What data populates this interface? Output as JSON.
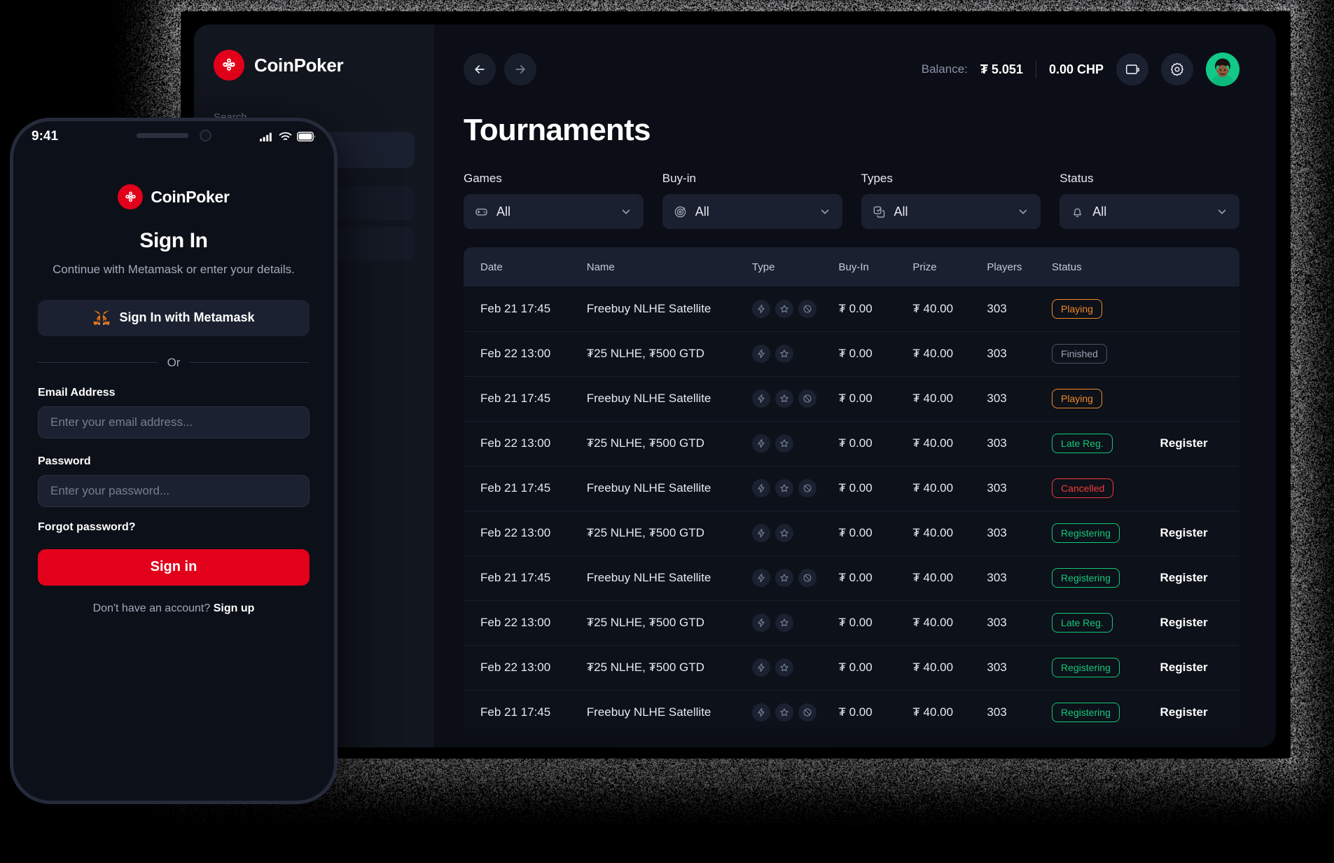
{
  "brand": {
    "name": "CoinPoker",
    "logo_icon": "coinpoker-clover-logo",
    "accent": "#e2001a"
  },
  "desktop": {
    "sidebar": {
      "search_label": "Search",
      "nav_items": [
        {
          "label": ""
        },
        {
          "label": ""
        }
      ]
    },
    "topbar": {
      "back_icon": "arrow-left-icon",
      "forward_icon": "arrow-right-icon",
      "balance_label": "Balance:",
      "balance_value": "₮ 5.051",
      "chp_value": "0.00 CHP",
      "wallet_icon": "wallet-icon",
      "settings_icon": "gear-icon",
      "avatar_icon": "user-avatar"
    },
    "page_title": "Tournaments",
    "filters": [
      {
        "label": "Games",
        "value": "All",
        "icon": "gamepad-icon",
        "chevron": "chevron-down-icon"
      },
      {
        "label": "Buy-in",
        "value": "All",
        "icon": "chip-icon",
        "chevron": "chevron-down-icon"
      },
      {
        "label": "Types",
        "value": "All",
        "icon": "copy-icon",
        "chevron": "chevron-down-icon"
      },
      {
        "label": "Status",
        "value": "All",
        "icon": "bell-icon",
        "chevron": "chevron-down-icon"
      }
    ],
    "table": {
      "columns": [
        "Date",
        "Name",
        "Type",
        "Buy-In",
        "Prize",
        "Players",
        "Status",
        ""
      ],
      "rows": [
        {
          "date": "Feb 21 17:45",
          "name": "Freebuy NLHE Satellite",
          "types": [
            "bolt-icon",
            "star-icon",
            "no-rebuy-icon"
          ],
          "buyin": "₮ 0.00",
          "prize": "₮ 40.00",
          "players": "303",
          "status": "Playing",
          "status_kind": "playing",
          "action": ""
        },
        {
          "date": "Feb 22 13:00",
          "name": "₮25 NLHE, ₮500 GTD",
          "types": [
            "bolt-icon",
            "star-icon"
          ],
          "buyin": "₮ 0.00",
          "prize": "₮ 40.00",
          "players": "303",
          "status": "Finished",
          "status_kind": "finished",
          "action": ""
        },
        {
          "date": "Feb 21 17:45",
          "name": "Freebuy NLHE Satellite",
          "types": [
            "bolt-icon",
            "star-icon",
            "no-rebuy-icon"
          ],
          "buyin": "₮ 0.00",
          "prize": "₮ 40.00",
          "players": "303",
          "status": "Playing",
          "status_kind": "playing",
          "action": ""
        },
        {
          "date": "Feb 22 13:00",
          "name": "₮25 NLHE, ₮500 GTD",
          "types": [
            "bolt-icon",
            "star-icon"
          ],
          "buyin": "₮ 0.00",
          "prize": "₮ 40.00",
          "players": "303",
          "status": "Late Reg.",
          "status_kind": "latereg",
          "action": "Register"
        },
        {
          "date": "Feb 21 17:45",
          "name": "Freebuy NLHE Satellite",
          "types": [
            "bolt-icon",
            "star-icon",
            "no-rebuy-icon"
          ],
          "buyin": "₮ 0.00",
          "prize": "₮ 40.00",
          "players": "303",
          "status": "Cancelled",
          "status_kind": "cancelled",
          "action": ""
        },
        {
          "date": "Feb 22 13:00",
          "name": "₮25 NLHE, ₮500 GTD",
          "types": [
            "bolt-icon",
            "star-icon"
          ],
          "buyin": "₮ 0.00",
          "prize": "₮ 40.00",
          "players": "303",
          "status": "Registering",
          "status_kind": "registering",
          "action": "Register"
        },
        {
          "date": "Feb 21 17:45",
          "name": "Freebuy NLHE Satellite",
          "types": [
            "bolt-icon",
            "star-icon",
            "no-rebuy-icon"
          ],
          "buyin": "₮ 0.00",
          "prize": "₮ 40.00",
          "players": "303",
          "status": "Registering",
          "status_kind": "registering",
          "action": "Register"
        },
        {
          "date": "Feb 22 13:00",
          "name": "₮25 NLHE, ₮500 GTD",
          "types": [
            "bolt-icon",
            "star-icon"
          ],
          "buyin": "₮ 0.00",
          "prize": "₮ 40.00",
          "players": "303",
          "status": "Late Reg.",
          "status_kind": "latereg",
          "action": "Register"
        },
        {
          "date": "Feb 22 13:00",
          "name": "₮25 NLHE, ₮500 GTD",
          "types": [
            "bolt-icon",
            "star-icon"
          ],
          "buyin": "₮ 0.00",
          "prize": "₮ 40.00",
          "players": "303",
          "status": "Registering",
          "status_kind": "registering",
          "action": "Register"
        },
        {
          "date": "Feb 21 17:45",
          "name": "Freebuy NLHE Satellite",
          "types": [
            "bolt-icon",
            "star-icon",
            "no-rebuy-icon"
          ],
          "buyin": "₮ 0.00",
          "prize": "₮ 40.00",
          "players": "303",
          "status": "Registering",
          "status_kind": "registering",
          "action": "Register"
        }
      ]
    }
  },
  "phone": {
    "status_bar": {
      "time": "9:41",
      "signal_icon": "cellular-signal-icon",
      "wifi_icon": "wifi-icon",
      "battery_icon": "battery-icon"
    },
    "title": "Sign In",
    "subtitle": "Continue with Metamask or enter your details.",
    "metamask_button": {
      "label": "Sign In with Metamask",
      "icon": "metamask-fox-icon"
    },
    "divider_text": "Or",
    "email": {
      "label": "Email Address",
      "placeholder": "Enter your email address...",
      "value": ""
    },
    "password": {
      "label": "Password",
      "placeholder": "Enter your password...",
      "value": ""
    },
    "forgot_label": "Forgot password?",
    "signin_label": "Sign in",
    "signup_prompt": "Don't have an account?",
    "signup_link": "Sign up"
  },
  "colors": {
    "accent_red": "#e2001a",
    "green": "#13c87a",
    "orange": "#f08a28",
    "red_status": "#ef3b3b",
    "gray_status": "#9aa3b8",
    "bg_dark": "#0b0e16",
    "panel": "#1a2030"
  }
}
